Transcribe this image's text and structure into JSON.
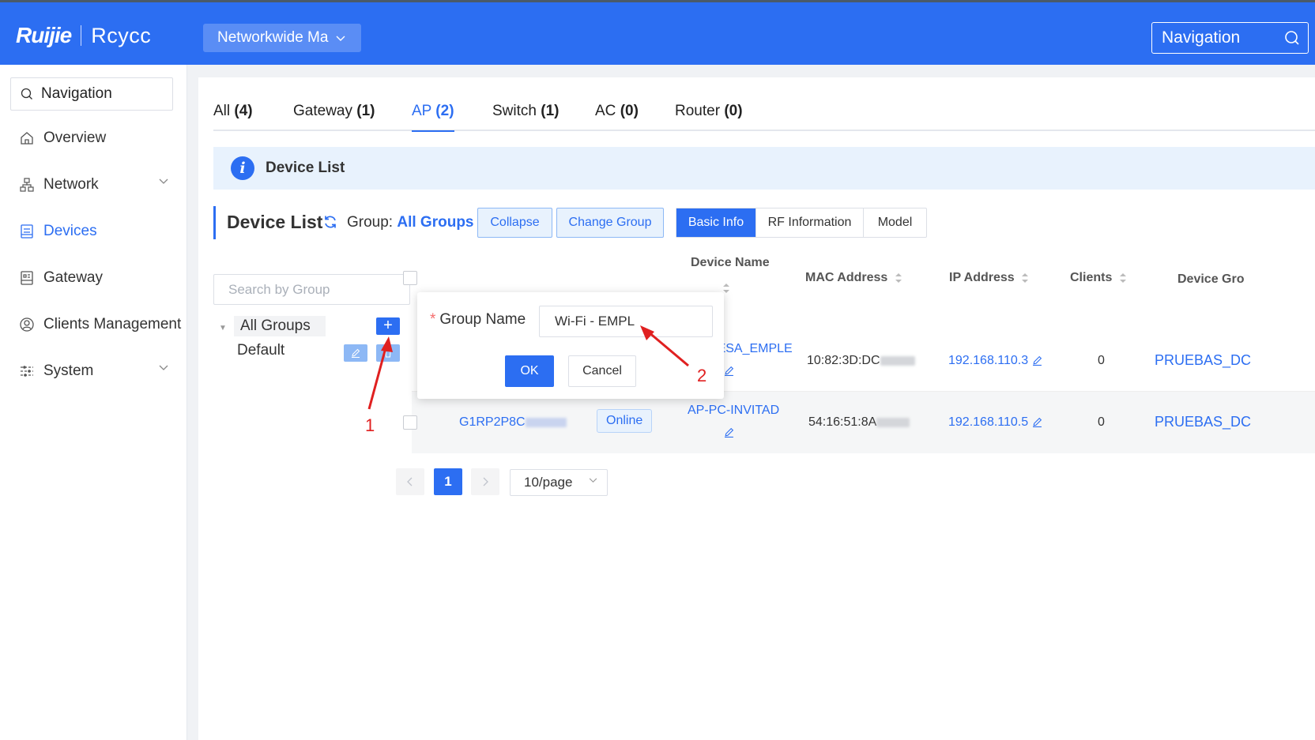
{
  "header": {
    "brand": "Ruijie",
    "sub_brand": "Rcycc",
    "network_select": "Networkwide Ma",
    "nav_search": "Navigation"
  },
  "sidebar": {
    "search": "Navigation",
    "items": [
      {
        "label": "Overview"
      },
      {
        "label": "Network"
      },
      {
        "label": "Devices"
      },
      {
        "label": "Gateway"
      },
      {
        "label": "Clients Management"
      },
      {
        "label": "System"
      }
    ]
  },
  "tabs": [
    {
      "label": "All",
      "count": "(4)"
    },
    {
      "label": "Gateway",
      "count": "(1)"
    },
    {
      "label": "AP",
      "count": "(2)"
    },
    {
      "label": "Switch",
      "count": "(1)"
    },
    {
      "label": "AC",
      "count": "(0)"
    },
    {
      "label": "Router",
      "count": "(0)"
    }
  ],
  "info_bar": {
    "text": "Device List"
  },
  "list_header": {
    "title": "Device List",
    "group_label": "Group:",
    "group_value": "All Groups",
    "collapse": "Collapse",
    "change_group": "Change Group",
    "views": [
      "Basic Info",
      "RF Information",
      "Model"
    ]
  },
  "group_tree": {
    "search_placeholder": "Search by Group",
    "root": "All Groups",
    "add": "+",
    "child": "Default"
  },
  "table": {
    "columns": {
      "device_name": "Device Name",
      "mac": "MAC Address",
      "ip": "IP Address",
      "clients": "Clients",
      "device_group": "Device Gro"
    },
    "rows": [
      {
        "device_name": "AP_MESA_EMPLE",
        "mac": "10:82:3D:DC",
        "ip": "192.168.110.3",
        "clients": "0",
        "group": "PRUEBAS_DC"
      },
      {
        "sn": "G1RP2P8C",
        "status": "Online",
        "device_name": "AP-PC-INVITAD",
        "mac": "54:16:51:8A",
        "ip": "192.168.110.5",
        "clients": "0",
        "group": "PRUEBAS_DC"
      }
    ]
  },
  "pagination": {
    "current": "1",
    "page_size": "10/page"
  },
  "popover": {
    "required_mark": "*",
    "label": "Group Name",
    "value": "Wi-Fi - EMPL",
    "ok": "OK",
    "cancel": "Cancel"
  },
  "annotations": [
    "1",
    "2"
  ]
}
